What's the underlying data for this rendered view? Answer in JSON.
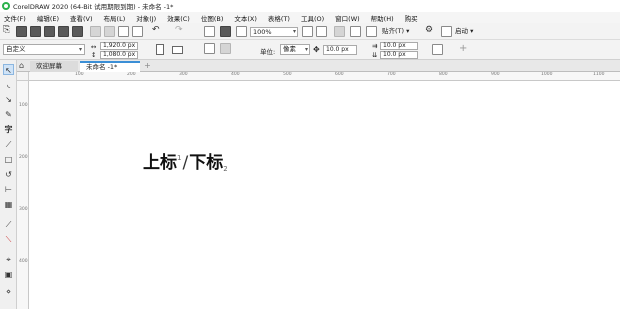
{
  "window": {
    "title": "CorelDRAW 2020 (64-Bit 试用期限到期) - 未命名 -1*"
  },
  "menu": [
    "文件(F)",
    "编辑(E)",
    "查看(V)",
    "布局(L)",
    "对象(J)",
    "效果(C)",
    "位图(B)",
    "文本(X)",
    "表格(T)",
    "工具(O)",
    "窗口(W)",
    "帮助(H)",
    "购买"
  ],
  "toolbar": {
    "zoom": "100%",
    "snap_label": "贴齐(T)",
    "launch_label": "启动"
  },
  "property_bar": {
    "preset": "自定义",
    "width": "1,920.0 px",
    "height": "1,080.0 px",
    "units_label": "单位:",
    "units_value": "像素",
    "nudge": "10.0 px",
    "dup_x": "10.0 px",
    "dup_y": "10.0 px"
  },
  "tabs": [
    {
      "label": "欢迎屏幕"
    },
    {
      "label": "未命名 -1*"
    }
  ],
  "rulers": {
    "h_ticks": [
      "100",
      "200",
      "300",
      "400",
      "500",
      "600",
      "700",
      "800",
      "900",
      "1000",
      "1100"
    ],
    "v_ticks": [
      "100",
      "200",
      "300",
      "400"
    ]
  },
  "canvas": {
    "text_main": "上标",
    "sup": "1",
    "slash": "/",
    "text_second": "下标",
    "sub": "2"
  }
}
